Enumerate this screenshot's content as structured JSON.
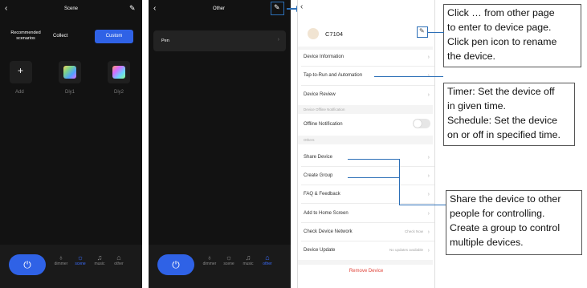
{
  "scene_screen": {
    "title": "Scene",
    "tab_recommended": "Recommended\nscenarios",
    "tab_collect": "Collect",
    "tab_custom": "Custom",
    "items": [
      {
        "label": "Add"
      },
      {
        "label": "Diy1"
      },
      {
        "label": "Diy2"
      }
    ]
  },
  "other_screen": {
    "title": "Other",
    "item_pen": "Pen"
  },
  "bottom_nav": {
    "dimmer": "dimmer",
    "scene": "scene",
    "music": "music",
    "other": "other"
  },
  "device_screen": {
    "device_name": "C7104",
    "rows": {
      "device_information": "Device Information",
      "tap_to_run": "Tap-to-Run and Automation",
      "device_review": "Device Review",
      "offline_section": "Device Offline Notification",
      "offline_notification": "Offline Notification",
      "others_section": "Others",
      "share_device": "Share Device",
      "create_group": "Create Group",
      "faq": "FAQ & Feedback",
      "add_home": "Add to Home Screen",
      "check_network": "Check Device Network",
      "check_network_value": "Check Now",
      "device_update": "Device Update",
      "device_update_value": "No updates available",
      "remove_device": "Remove Device"
    }
  },
  "callouts": {
    "c1": [
      "Click … from other page",
      "to enter to device page.",
      "Click pen icon to rename",
      "the device."
    ],
    "c2": [
      "Timer: Set the device off",
      "in given time.",
      "Schedule: Set the device",
      "on or off in specified time."
    ],
    "c3": [
      "Share the device to other",
      "people for controlling.",
      "Create a group to control",
      "multiple devices."
    ]
  },
  "colors": {
    "accent_blue": "#2f62e6",
    "connector_blue": "#2c6fb7",
    "phone_bg": "#121212"
  }
}
